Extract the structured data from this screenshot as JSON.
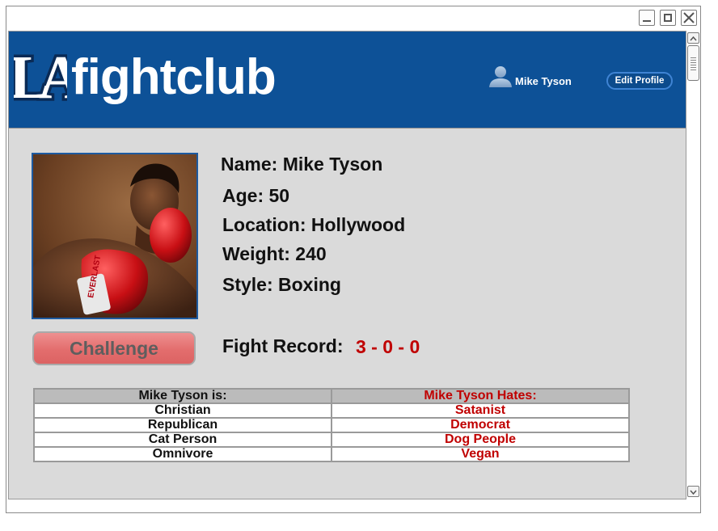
{
  "brand": {
    "logo_text": "LA",
    "name": "fightclub"
  },
  "header": {
    "user_name": "Mike Tyson",
    "edit_profile_label": "Edit Profile"
  },
  "profile": {
    "name_line": "Name: Mike Tyson",
    "age_line": "Age: 50",
    "location_line": "Location: Hollywood",
    "weight_line": "Weight: 240",
    "style_line": "Style: Boxing"
  },
  "actions": {
    "challenge_label": "Challenge"
  },
  "record": {
    "label": "Fight Record:",
    "value": "3 - 0 - 0"
  },
  "traits_table": {
    "col_is": "Mike Tyson is:",
    "col_hates": "Mike Tyson Hates:",
    "rows": [
      {
        "is": "Christian",
        "hates": "Satanist"
      },
      {
        "is": "Republican",
        "hates": "Democrat"
      },
      {
        "is": "Cat Person",
        "hates": "Dog People"
      },
      {
        "is": "Omnivore",
        "hates": "Vegan"
      }
    ]
  },
  "colors": {
    "header_bg": "#0d5197",
    "accent_red": "#c00000",
    "challenge": "#e36d6d"
  },
  "icons": [
    "minimize-icon",
    "maximize-icon",
    "close-icon",
    "user-icon",
    "scroll-up-icon",
    "scroll-down-icon"
  ]
}
